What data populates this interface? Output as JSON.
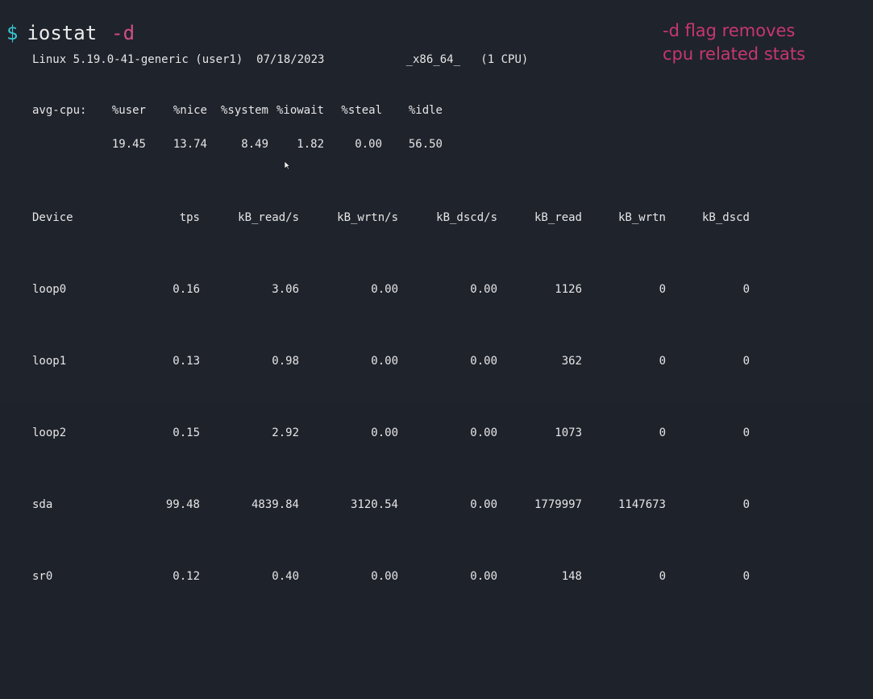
{
  "prompt": {
    "symbol": "$",
    "command": "iostat",
    "flag": "-d"
  },
  "annotation": {
    "line1": "-d flag removes",
    "line2": "cpu related stats"
  },
  "sysinfo": "Linux 5.19.0-41-generic (user1)  07/18/2023            _x86_64_   (1 CPU)",
  "cpu": {
    "label": "avg-cpu:",
    "headers": [
      "%user",
      "%nice",
      "%system",
      "%iowait",
      "%steal",
      "%idle"
    ],
    "values": [
      "19.45",
      "13.74",
      "8.49",
      "1.82",
      "0.00",
      "56.50"
    ]
  },
  "devices": {
    "headers": [
      "Device",
      "tps",
      "kB_read/s",
      "kB_wrtn/s",
      "kB_dscd/s",
      "kB_read",
      "kB_wrtn",
      "kB_dscd"
    ],
    "rows": [
      [
        "loop0",
        "0.16",
        "3.06",
        "0.00",
        "0.00",
        "1126",
        "0",
        "0"
      ],
      [
        "loop1",
        "0.13",
        "0.98",
        "0.00",
        "0.00",
        "362",
        "0",
        "0"
      ],
      [
        "loop2",
        "0.15",
        "2.92",
        "0.00",
        "0.00",
        "1073",
        "0",
        "0"
      ],
      [
        "sda",
        "99.48",
        "4839.84",
        "3120.54",
        "0.00",
        "1779997",
        "1147673",
        "0"
      ],
      [
        "sr0",
        "0.12",
        "0.40",
        "0.00",
        "0.00",
        "148",
        "0",
        "0"
      ]
    ]
  },
  "colors": {
    "background": "#1f232c",
    "prompt": "#39c5cf",
    "flag": "#d14f84",
    "annotation": "#c7376f",
    "text": "#e6e6e6"
  }
}
